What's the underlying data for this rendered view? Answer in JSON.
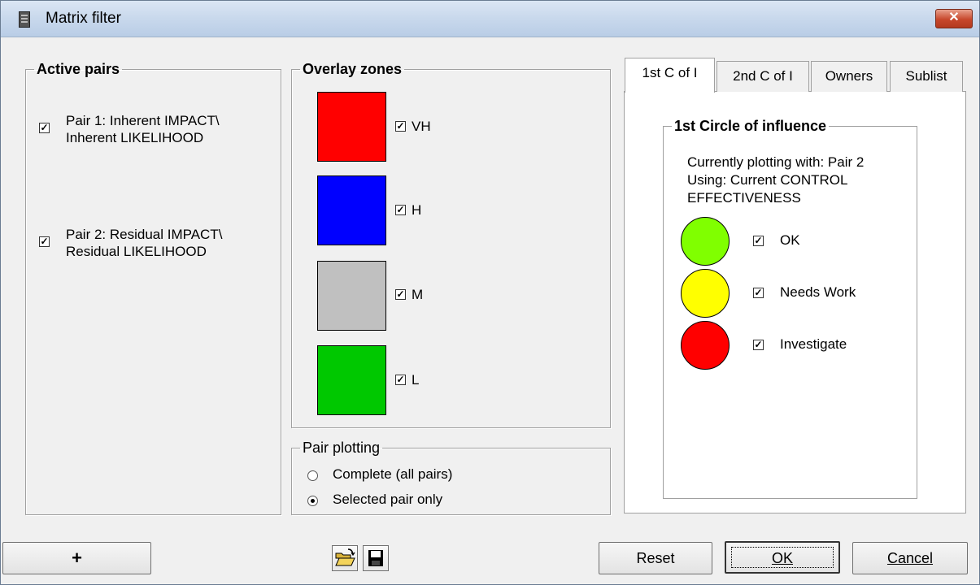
{
  "window": {
    "title": "Matrix filter",
    "close_glyph": "✕"
  },
  "active_pairs": {
    "legend": "Active pairs",
    "items": [
      {
        "line1": "Pair 1: Inherent IMPACT\\",
        "line2": "Inherent LIKELIHOOD",
        "checked": true
      },
      {
        "line1": "Pair 2: Residual IMPACT\\",
        "line2": "Residual LIKELIHOOD",
        "checked": true
      }
    ]
  },
  "overlay_zones": {
    "legend": "Overlay zones",
    "zones": [
      {
        "label": "VH",
        "color": "#ff0000",
        "checked": true
      },
      {
        "label": "H",
        "color": "#0000ff",
        "checked": true
      },
      {
        "label": "M",
        "color": "#c0c0c0",
        "checked": true
      },
      {
        "label": "L",
        "color": "#00c800",
        "checked": true
      }
    ]
  },
  "pair_plotting": {
    "legend": "Pair plotting",
    "options": [
      {
        "label": "Complete  (all pairs)",
        "selected": false
      },
      {
        "label": "Selected pair only",
        "selected": true
      }
    ]
  },
  "tabs": [
    "1st C of I",
    "2nd C of I",
    "Owners",
    "Sublist"
  ],
  "active_tab": 0,
  "circle_panel": {
    "legend": "1st Circle of influence",
    "info_line1": "Currently plotting with: Pair 2",
    "info_line2": "Using: Current CONTROL",
    "info_line3": "EFFECTIVENESS",
    "items": [
      {
        "label": "OK",
        "color": "#80ff00",
        "checked": true
      },
      {
        "label": "Needs Work",
        "color": "#ffff00",
        "checked": true
      },
      {
        "label": "Investigate",
        "color": "#ff0000",
        "checked": true
      }
    ]
  },
  "footer": {
    "add_label": "+",
    "open_icon": "open-folder-icon",
    "save_icon": "floppy-disk-icon",
    "reset_label": "Reset",
    "ok_label": "OK",
    "cancel_label": "Cancel"
  },
  "check_glyph": "✓"
}
